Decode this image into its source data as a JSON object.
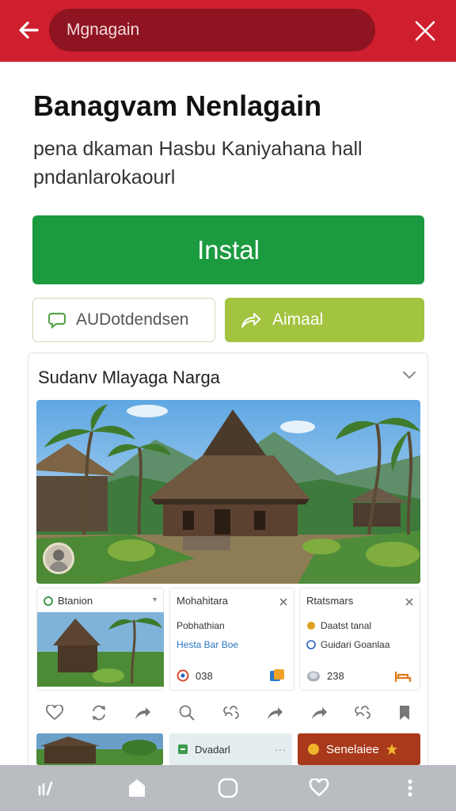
{
  "topbar": {
    "url_text": "Mgnagain",
    "bg_color": "#cf1f2e"
  },
  "page": {
    "title": "Banagvam Nenlagain",
    "description": "pena dkaman Hasbu Kaniyahana hall pndanlarokaourl"
  },
  "buttons": {
    "install_label": "Instal",
    "secondary_label": "AUDotdendsen",
    "share_label": "Aimaal",
    "install_color": "#1b9a3f",
    "share_color": "#a3c441"
  },
  "card": {
    "title": "Sudanv Mlayaga Narga",
    "minis": [
      {
        "header": "Btanion",
        "footer": ""
      },
      {
        "header": "Mohahitara",
        "line1": "Pobhathian",
        "line2": "Hesta Bar Boe",
        "footer": "038"
      },
      {
        "header": "Rtatsmars",
        "line1": "Daatst tanal",
        "line2": "Guidari Goanlaa",
        "footer": "238"
      }
    ],
    "strip_mid_label": "Dvadarl",
    "strip_right_label": "Senelaiee"
  },
  "icons": {
    "back": "arrow-left-icon",
    "close": "close-icon",
    "chat": "chat-bubble-icon",
    "share": "share-arrow-icon",
    "chevron": "chevron-down-icon",
    "bookmark": "bookmark-icon",
    "home": "home-icon",
    "recents": "recents-icon",
    "circle": "home-circle-icon",
    "heart": "heart-icon",
    "more": "more-vertical-icon"
  }
}
